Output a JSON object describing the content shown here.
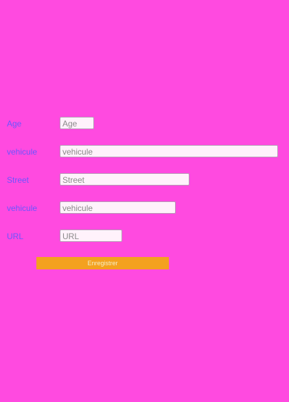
{
  "form": {
    "fields": [
      {
        "label": "Age",
        "placeholder": "Age"
      },
      {
        "label": "vehicule",
        "placeholder": "vehicule"
      },
      {
        "label": "Street",
        "placeholder": "Street"
      },
      {
        "label": "vehicule",
        "placeholder": "vehicule"
      },
      {
        "label": "URL",
        "placeholder": "URL"
      }
    ],
    "submit_label": "Enregistrer"
  },
  "colors": {
    "background": "#ff4ae0",
    "label_text": "#6a55ff",
    "input_background": "#fff2fb",
    "button_background": "#f4a11f",
    "button_text": "#f4f0c8"
  }
}
